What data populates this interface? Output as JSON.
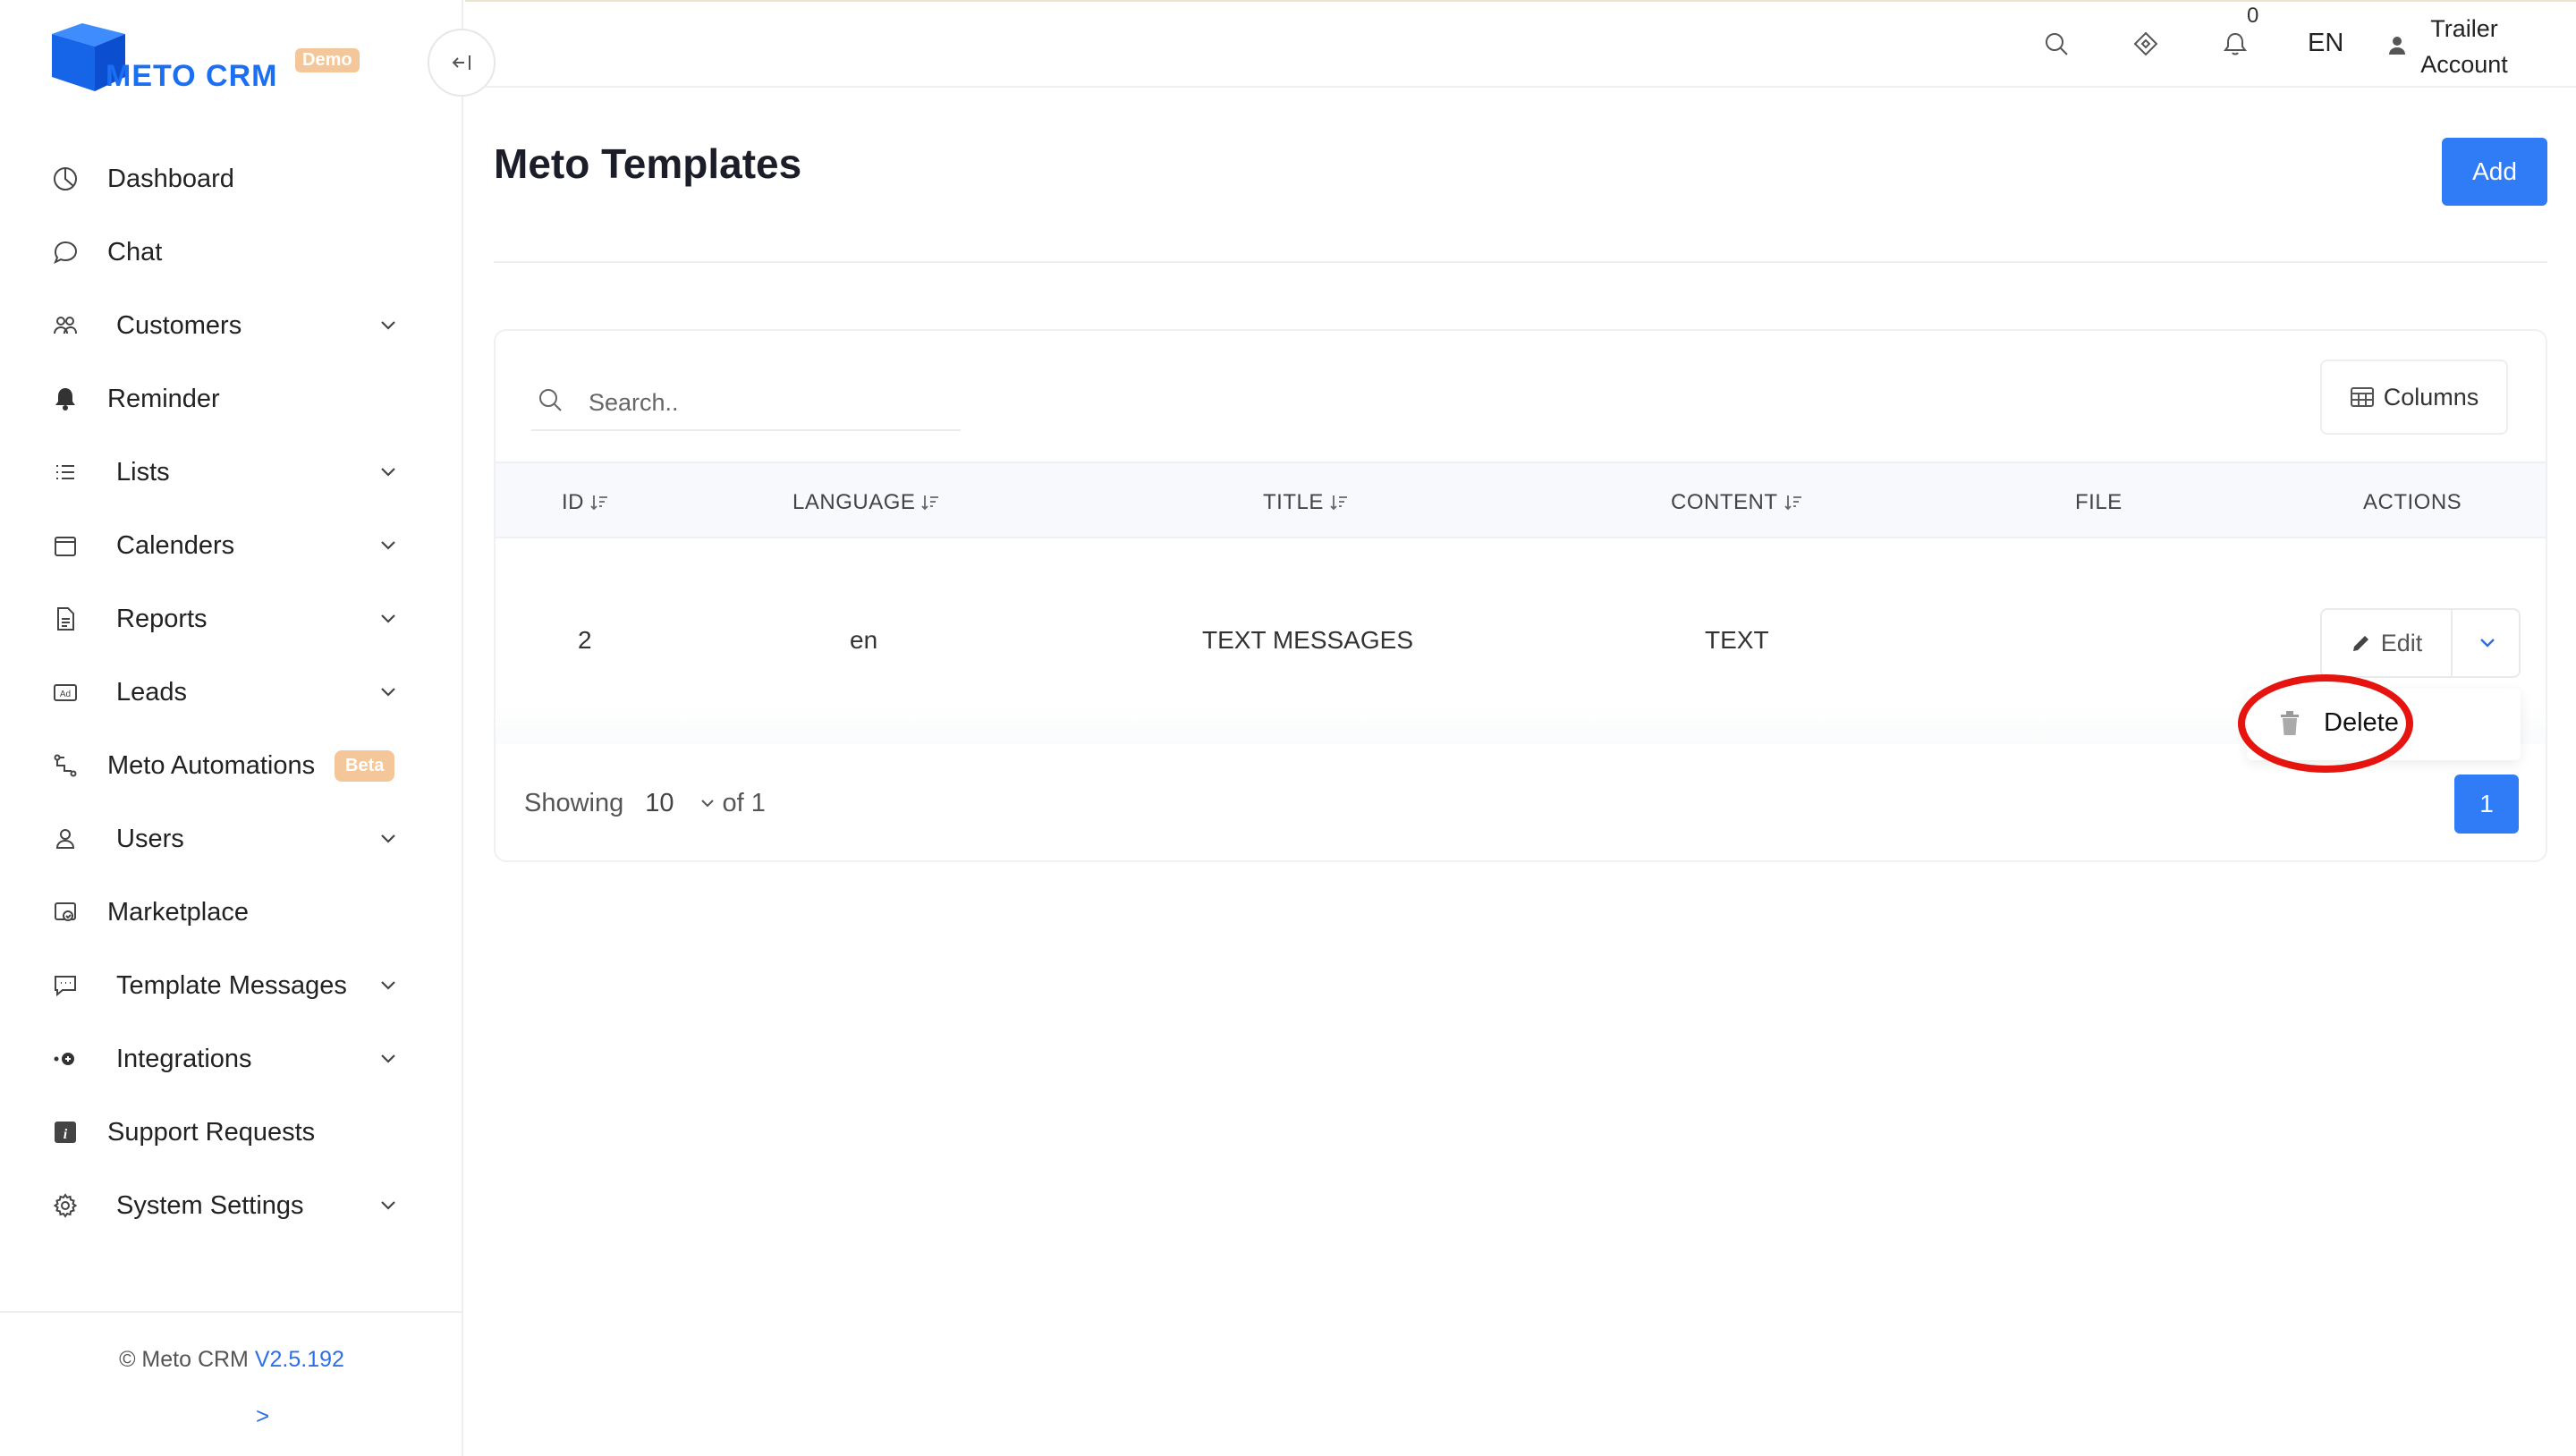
{
  "brand": {
    "name": "METO CRM",
    "badge": "Demo",
    "primary_color": "#2f7cf6"
  },
  "sidebar": {
    "items": [
      {
        "label": "Dashboard",
        "icon": "dashboard-icon",
        "has_submenu": false
      },
      {
        "label": "Chat",
        "icon": "chat-bubble-icon",
        "has_submenu": false
      },
      {
        "label": "Customers",
        "icon": "customers-icon",
        "has_submenu": true
      },
      {
        "label": "Reminder",
        "icon": "bell-icon",
        "has_submenu": false
      },
      {
        "label": "Lists",
        "icon": "list-icon",
        "has_submenu": true
      },
      {
        "label": "Calenders",
        "icon": "calendar-icon",
        "has_submenu": true
      },
      {
        "label": "Reports",
        "icon": "report-icon",
        "has_submenu": true
      },
      {
        "label": "Leads",
        "icon": "ad-icon",
        "has_submenu": true
      },
      {
        "label": "Meto Automations",
        "icon": "automation-icon",
        "has_submenu": false,
        "badge": "Beta"
      },
      {
        "label": "Users",
        "icon": "user-icon",
        "has_submenu": true
      },
      {
        "label": "Marketplace",
        "icon": "marketplace-icon",
        "has_submenu": false
      },
      {
        "label": "Template Messages",
        "icon": "template-message-icon",
        "has_submenu": true
      },
      {
        "label": "Integrations",
        "icon": "integrations-icon",
        "has_submenu": true
      },
      {
        "label": "Support Requests",
        "icon": "info-icon",
        "has_submenu": false
      },
      {
        "label": "System Settings",
        "icon": "gear-icon",
        "has_submenu": true
      }
    ],
    "footer": {
      "copyright": "© Meto CRM",
      "version": "V2.5.192",
      "expand": ">"
    }
  },
  "topbar": {
    "notification_count": "0",
    "language": "EN",
    "user_line1": "Trailer",
    "user_line2": "Account"
  },
  "page": {
    "title": "Meto Templates",
    "add_label": "Add"
  },
  "table": {
    "search_placeholder": "Search..",
    "columns_label": "Columns",
    "headers": {
      "id": "ID",
      "language": "LANGUAGE",
      "title": "TITLE",
      "content": "CONTENT",
      "file": "FILE",
      "actions": "ACTIONS"
    },
    "rows": [
      {
        "id": "2",
        "language": "en",
        "title": "TEXT MESSAGES",
        "content": "TEXT",
        "file": ""
      }
    ],
    "edit_label": "Edit",
    "delete_label": "Delete",
    "footer": {
      "showing": "Showing",
      "page_size": "10",
      "of": "of 1",
      "current_page": "1"
    }
  }
}
